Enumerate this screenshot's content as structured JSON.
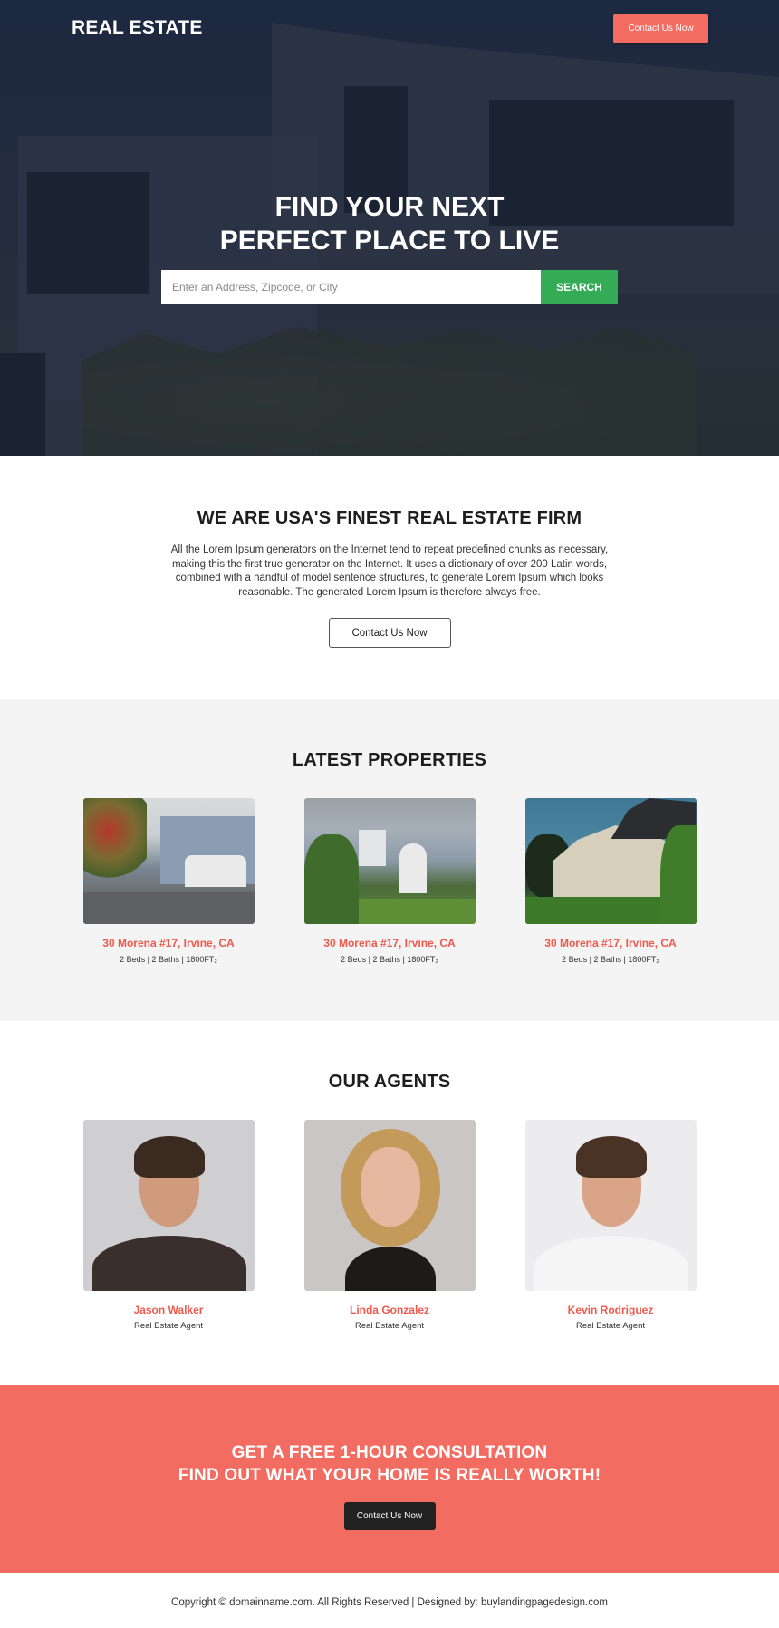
{
  "header": {
    "logo": "REAL ESTATE",
    "contact_button": "Contact Us Now"
  },
  "hero": {
    "title_line1": "FIND YOUR NEXT",
    "title_line2": "PERFECT PLACE TO LIVE",
    "search_placeholder": "Enter an Address, Zipcode, or City",
    "search_value": "",
    "search_button": "SEARCH"
  },
  "about": {
    "title": "WE ARE USA'S FINEST REAL ESTATE FIRM",
    "body": "All the Lorem Ipsum generators on the Internet tend to repeat predefined chunks as necessary, making this the first true generator on the Internet. It uses a dictionary of over 200 Latin words, combined with a handful of model sentence structures, to generate Lorem Ipsum which looks reasonable. The generated Lorem Ipsum is therefore always free.",
    "button": "Contact Us Now"
  },
  "properties": {
    "title": "LATEST PROPERTIES",
    "items": [
      {
        "address": "30 Morena #17, Irvine, CA",
        "details": "2 Beds | 2 Baths | 1800FT₂",
        "image": "suburban-house-blue-siding-garage"
      },
      {
        "address": "30 Morena #17, Irvine, CA",
        "details": "2 Beds | 2 Baths | 1800FT₂",
        "image": "house-with-hedges-front-door"
      },
      {
        "address": "30 Morena #17, Irvine, CA",
        "details": "2 Beds | 2 Baths | 1800FT₂",
        "image": "large-house-on-hill-blue-sky"
      }
    ]
  },
  "agents": {
    "title": "OUR AGENTS",
    "items": [
      {
        "name": "Jason Walker",
        "role": "Real Estate Agent"
      },
      {
        "name": "Linda Gonzalez",
        "role": "Real Estate Agent"
      },
      {
        "name": "Kevin Rodriguez",
        "role": "Real Estate Agent"
      }
    ]
  },
  "cta": {
    "line1": "GET A FREE 1-HOUR CONSULTATION",
    "line2": "FIND OUT WHAT YOUR HOME IS REALLY WORTH!",
    "button": "Contact Us Now"
  },
  "footer": {
    "text": "Copyright © domainname.com. All Rights Reserved | Designed by: buylandingpagedesign.com"
  },
  "colors": {
    "accent": "#f26c62",
    "search_button": "#34ac55",
    "hero_dark": "#223049",
    "section_gray": "#f4f4f4",
    "dark_button": "#222222"
  }
}
